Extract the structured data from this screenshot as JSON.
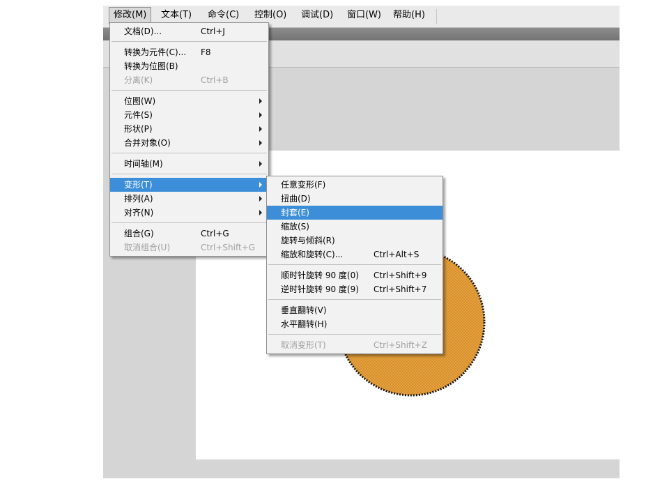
{
  "menubar": {
    "items": [
      {
        "label": "修改(M)"
      },
      {
        "label": "文本(T)"
      },
      {
        "label": "命令(C)"
      },
      {
        "label": "控制(O)"
      },
      {
        "label": "调试(D)"
      },
      {
        "label": "窗口(W)"
      },
      {
        "label": "帮助(H)"
      }
    ]
  },
  "modify_menu": {
    "items": [
      {
        "label": "文档(D)...",
        "shortcut": "Ctrl+J"
      },
      {
        "label": "转换为元件(C)...",
        "shortcut": "F8"
      },
      {
        "label": "转换为位图(B)",
        "shortcut": ""
      },
      {
        "label": "分离(K)",
        "shortcut": "Ctrl+B"
      },
      {
        "label": "位图(W)"
      },
      {
        "label": "元件(S)"
      },
      {
        "label": "形状(P)"
      },
      {
        "label": "合并对象(O)"
      },
      {
        "label": "时间轴(M)"
      },
      {
        "label": "变形(T)"
      },
      {
        "label": "排列(A)"
      },
      {
        "label": "对齐(N)"
      },
      {
        "label": "组合(G)",
        "shortcut": "Ctrl+G"
      },
      {
        "label": "取消组合(U)",
        "shortcut": "Ctrl+Shift+G"
      }
    ]
  },
  "transform_menu": {
    "items": [
      {
        "label": "任意变形(F)",
        "shortcut": ""
      },
      {
        "label": "扭曲(D)",
        "shortcut": ""
      },
      {
        "label": "封套(E)",
        "shortcut": ""
      },
      {
        "label": "缩放(S)",
        "shortcut": ""
      },
      {
        "label": "旋转与倾斜(R)",
        "shortcut": ""
      },
      {
        "label": "缩放和旋转(C)...",
        "shortcut": "Ctrl+Alt+S"
      },
      {
        "label": "顺时针旋转 90 度(0)",
        "shortcut": "Ctrl+Shift+9"
      },
      {
        "label": "逆时针旋转 90 度(9)",
        "shortcut": "Ctrl+Shift+7"
      },
      {
        "label": "垂直翻转(V)",
        "shortcut": ""
      },
      {
        "label": "水平翻转(H)",
        "shortcut": ""
      },
      {
        "label": "取消变形(T)",
        "shortcut": "Ctrl+Shift+Z"
      }
    ]
  },
  "colors": {
    "highlight": "#3c8ed8",
    "shape_fill": "#e8a03a",
    "shape_stroke": "#111111"
  }
}
